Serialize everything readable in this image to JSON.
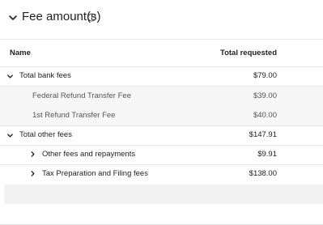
{
  "section": {
    "title": "Fee amount(s)",
    "collapse_icon": "chevron-down-icon",
    "info_icon": "info-circle-icon"
  },
  "table": {
    "headers": {
      "name": "Name",
      "total": "Total requested"
    },
    "rows": [
      {
        "label": "Total bank fees",
        "amount": "$79.00",
        "icon": "chevron-down-icon"
      },
      {
        "label": "Federal Refund Transfer Fee",
        "amount": "$39.00"
      },
      {
        "label": "1st Refund Transfer Fee",
        "amount": "$40.00"
      },
      {
        "label": "Total other fees",
        "amount": "$147.91",
        "icon": "chevron-down-icon"
      },
      {
        "label": "Other fees and repayments",
        "amount": "$9.91",
        "icon": "chevron-right-icon"
      },
      {
        "label": "Tax Preparation and Filing fees",
        "amount": "$138.00",
        "icon": "chevron-right-icon"
      }
    ]
  }
}
